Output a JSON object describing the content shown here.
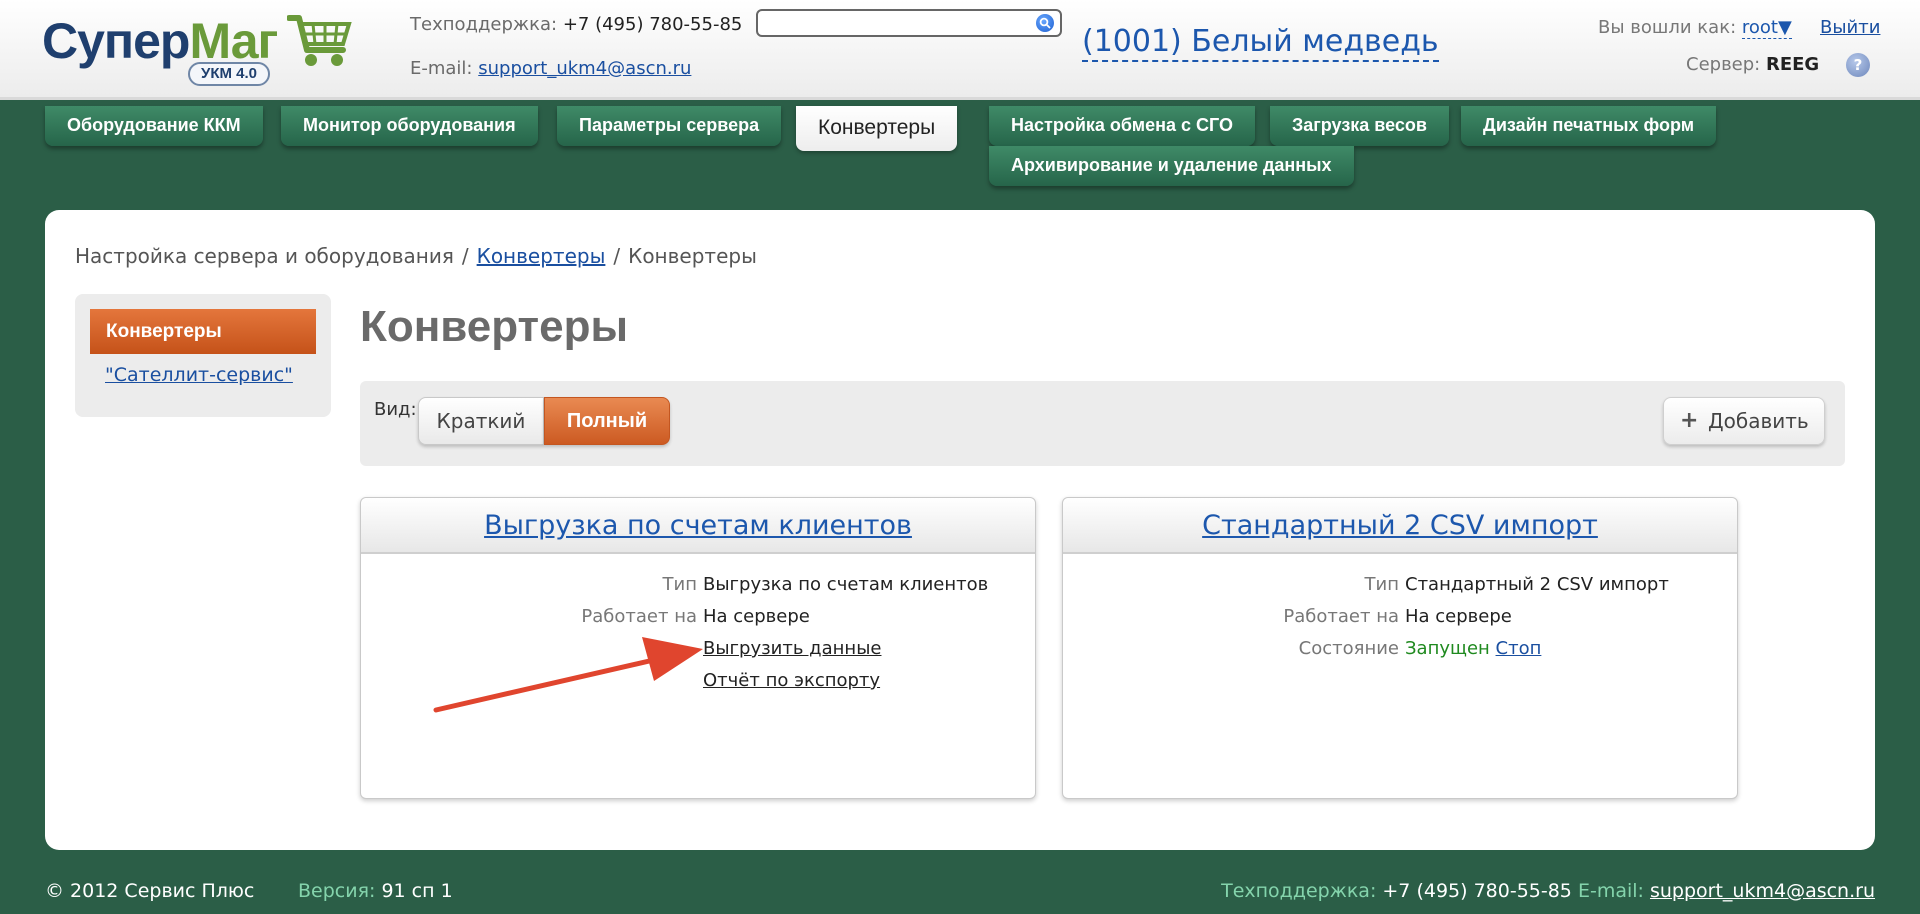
{
  "header": {
    "logo": {
      "word_part1": "Супер",
      "word_part2": "Маг",
      "badge": "УКМ 4.0"
    },
    "support_label": "Техподдержка:",
    "support_phone": "+7 (495) 780-55-85",
    "email_label": "E-mail:",
    "email": "support_ukm4@ascn.ru",
    "search_value": "",
    "store": "(1001) Белый медведь",
    "login_label": "Вы вошли как:",
    "user": "root",
    "user_dropdown_icon": "▼",
    "logout": "Выйти",
    "server_label": "Сервер:",
    "server": "REEG",
    "help_icon": "?"
  },
  "nav": {
    "tabs": [
      {
        "label": "Оборудование ККМ"
      },
      {
        "label": "Монитор оборудования"
      },
      {
        "label": "Параметры сервера"
      },
      {
        "label": "Конвертеры"
      },
      {
        "label": "Настройка обмена с СГО"
      },
      {
        "label": "Загрузка весов"
      },
      {
        "label": "Дизайн печатных форм"
      },
      {
        "label": "Архивирование и удаление данных"
      }
    ],
    "active_tab": "Конвертеры"
  },
  "breadcrumb": {
    "items": [
      "Настройка сервера и оборудования",
      "Конвертеры",
      "Конвертеры"
    ],
    "separator": "/"
  },
  "sidebar": {
    "active": "Конвертеры",
    "link": "\"Сателлит-сервис\""
  },
  "page_title": "Конвертеры",
  "view_bar": {
    "label": "Вид:",
    "short": "Краткий",
    "full": "Полный",
    "selected": "Полный",
    "add_icon": "+",
    "add": "Добавить"
  },
  "cards": [
    {
      "title": "Выгрузка по счетам клиентов",
      "type_label": "Тип",
      "type": "Выгрузка по счетам клиентов",
      "runs_on_label": "Работает на",
      "runs_on": "На сервере",
      "links": [
        "Выгрузить данные",
        "Отчёт по экспорту"
      ]
    },
    {
      "title": "Стандартный 2 CSV импорт",
      "type_label": "Тип",
      "type": "Стандартный 2 CSV импорт",
      "runs_on_label": "Работает на",
      "runs_on": "На сервере",
      "state_label": "Состояние",
      "state": "Запущен",
      "stop": "Стоп"
    }
  ],
  "footer": {
    "copyright": "© 2012 Сервис Плюс",
    "version_label": "Версия:",
    "version": "91 сп 1",
    "support_label": "Техподдержка:",
    "support_phone": "+7 (495) 780-55-85",
    "email_label": "E-mail:",
    "email": "support_ukm4@ascn.ru"
  },
  "colors": {
    "background": "#2b5e47",
    "tab": "#2f7556",
    "accent_orange": "#d9662c",
    "link": "#1c57ad",
    "status_ok": "#1f8a1f",
    "annotation_arrow": "#e0452e"
  }
}
